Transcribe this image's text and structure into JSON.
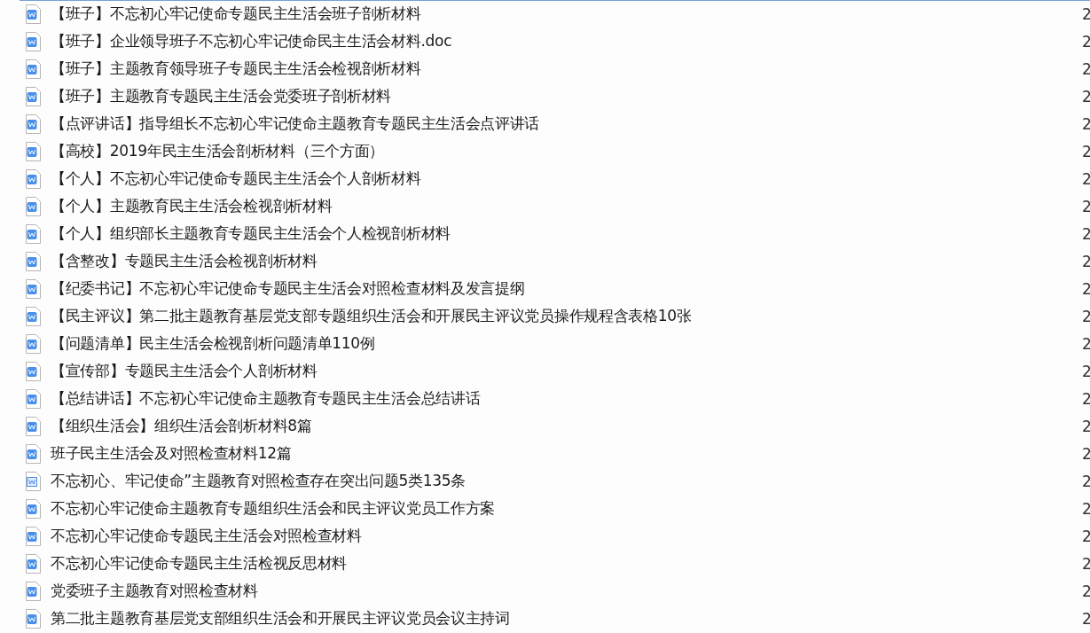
{
  "files": [
    {
      "name": "【班子】不忘初心牢记使命专题民主生活会班子剖析材料",
      "kind": "filled",
      "column_2": "2"
    },
    {
      "name": "【班子】企业领导班子不忘初心牢记使命民主生活会材料.doc",
      "kind": "filled",
      "column_2": "2"
    },
    {
      "name": "【班子】主题教育领导班子专题民主生活会检视剖析材料",
      "kind": "filled",
      "column_2": "2"
    },
    {
      "name": "【班子】主题教育专题民主生活会党委班子剖析材料",
      "kind": "filled",
      "column_2": "2"
    },
    {
      "name": "【点评讲话】指导组长不忘初心牢记使命主题教育专题民主生活会点评讲话",
      "kind": "filled",
      "column_2": "2"
    },
    {
      "name": "【高校】2019年民主生活会剖析材料（三个方面）",
      "kind": "filled",
      "column_2": "2"
    },
    {
      "name": "【个人】不忘初心牢记使命专题民主生活会个人剖析材料",
      "kind": "filled",
      "column_2": "2"
    },
    {
      "name": "【个人】主题教育民主生活会检视剖析材料",
      "kind": "filled",
      "column_2": "2"
    },
    {
      "name": "【个人】组织部长主题教育专题民主生活会个人检视剖析材料",
      "kind": "filled",
      "column_2": "2"
    },
    {
      "name": "【含整改】专题民主生活会检视剖析材料",
      "kind": "filled",
      "column_2": "2"
    },
    {
      "name": "【纪委书记】不忘初心牢记使命专题民主生活会对照检查材料及发言提纲",
      "kind": "filled",
      "column_2": "2"
    },
    {
      "name": "【民主评议】第二批主题教育基层党支部专题组织生活会和开展民主评议党员操作规程含表格10张",
      "kind": "filled",
      "column_2": "2"
    },
    {
      "name": "【问题清单】民主生活会检视剖析问题清单110例",
      "kind": "filled",
      "column_2": "2"
    },
    {
      "name": "【宣传部】专题民主生活会个人剖析材料",
      "kind": "filled",
      "column_2": "2"
    },
    {
      "name": "【总结讲话】不忘初心牢记使命主题教育专题民主生活会总结讲话",
      "kind": "filled",
      "column_2": "2"
    },
    {
      "name": "【组织生活会】组织生活会剖析材料8篇",
      "kind": "filled",
      "column_2": "2"
    },
    {
      "name": "班子民主生活会及对照检查材料12篇",
      "kind": "filled",
      "column_2": "2"
    },
    {
      "name": "不忘初心、牢记使命”主题教育对照检查存在突出问题5类135条",
      "kind": "outline",
      "column_2": "2"
    },
    {
      "name": "不忘初心牢记使命主题教育专题组织生活会和民主评议党员工作方案",
      "kind": "filled",
      "column_2": "2"
    },
    {
      "name": "不忘初心牢记使命专题民主生活会对照检查材料",
      "kind": "filled",
      "column_2": "2"
    },
    {
      "name": "不忘初心牢记使命专题民主生活检视反思材料",
      "kind": "filled",
      "column_2": "2"
    },
    {
      "name": "党委班子主题教育对照检查材料",
      "kind": "filled",
      "column_2": "2"
    },
    {
      "name": "第二批主题教育基层党支部组织生活会和开展民主评议党员会议主持词",
      "kind": "filled",
      "column_2": "2"
    }
  ]
}
